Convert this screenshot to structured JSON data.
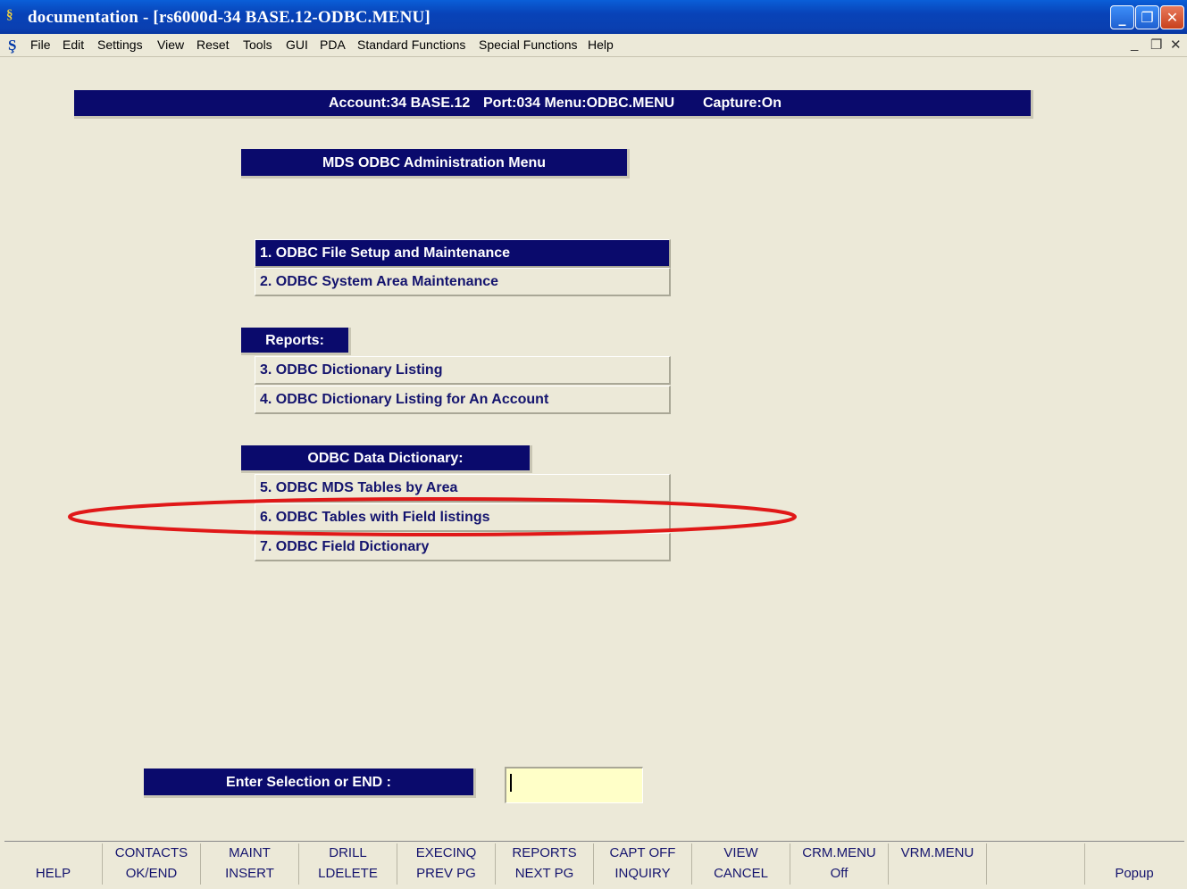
{
  "window": {
    "title": "documentation - [rs6000d-34 BASE.12-ODBC.MENU]",
    "app_icon": "sh-logo-icon",
    "controls": [
      "minimize-icon",
      "restore-icon",
      "close-icon"
    ]
  },
  "menubar": {
    "icon": "sh-logo-icon",
    "items": [
      "File",
      "Edit",
      "Settings",
      "View",
      "Reset",
      "Tools",
      "GUI",
      "PDA",
      "Standard Functions",
      "Special Functions",
      "Help"
    ],
    "doc_controls": [
      "minimize-icon",
      "restore-icon",
      "close-icon"
    ]
  },
  "status": {
    "account": "Account:34 BASE.12",
    "port_menu": "Port:034 Menu:ODBC.MENU",
    "capture": "Capture:On"
  },
  "menu_title": "MDS ODBC Administration Menu",
  "options": [
    {
      "label": "1. ODBC File Setup and Maintenance",
      "selected": true
    },
    {
      "label": "2. ODBC System Area Maintenance"
    }
  ],
  "reports": {
    "header": "Reports:",
    "options": [
      {
        "label": "3. ODBC Dictionary Listing"
      },
      {
        "label": "4. ODBC Dictionary Listing for An Account"
      }
    ]
  },
  "dictionary": {
    "header": "ODBC Data Dictionary:",
    "options": [
      {
        "label": "5. ODBC MDS Tables by Area"
      },
      {
        "label": "6. ODBC Tables with Field listings",
        "highlighted": true
      },
      {
        "label": "7. ODBC Field Dictionary"
      }
    ]
  },
  "prompt": {
    "label": "Enter Selection or END :",
    "value": ""
  },
  "annotation_color": "#e01818",
  "function_keys": {
    "row1": [
      "",
      "CONTACTS",
      "MAINT",
      "DRILL",
      "EXECINQ",
      "REPORTS",
      "CAPT OFF",
      "VIEW",
      "CRM.MENU",
      "VRM.MENU",
      "",
      ""
    ],
    "row2": [
      "HELP",
      "OK/END",
      "INSERT",
      "LDELETE",
      "PREV PG",
      "NEXT PG",
      "INQUIRY",
      "CANCEL",
      "Off",
      "",
      "",
      "Popup"
    ]
  }
}
